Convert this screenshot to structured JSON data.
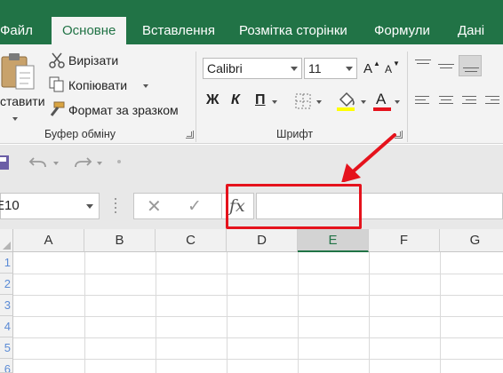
{
  "tabs": [
    "Файл",
    "Основне",
    "Вставлення",
    "Розмітка сторінки",
    "Формули",
    "Дані"
  ],
  "active_tab": "Основне",
  "clipboard": {
    "paste": "ставити",
    "cut": "Вирізати",
    "copy": "Копіювати",
    "format_painter": "Формат за зразком",
    "group_label": "Буфер обміну"
  },
  "font": {
    "name": "Calibri",
    "size": "11",
    "grow_label": "A",
    "shrink_label": "A",
    "bold": "Ж",
    "italic": "К",
    "underline": "П",
    "font_color_label": "A",
    "group_label": "Шрифт",
    "fill_color": "#ffff00",
    "font_color": "#e5121c"
  },
  "formula_bar": {
    "name_box": "E10",
    "fx": "fx",
    "value": ""
  },
  "columns": [
    "A",
    "B",
    "C",
    "D",
    "E",
    "F",
    "G"
  ],
  "selected_column": "E",
  "rows": [
    "1",
    "2",
    "3",
    "4",
    "5",
    "6"
  ],
  "annotation": {
    "color": "#e5121c"
  },
  "theme": {
    "accent": "#217346"
  }
}
